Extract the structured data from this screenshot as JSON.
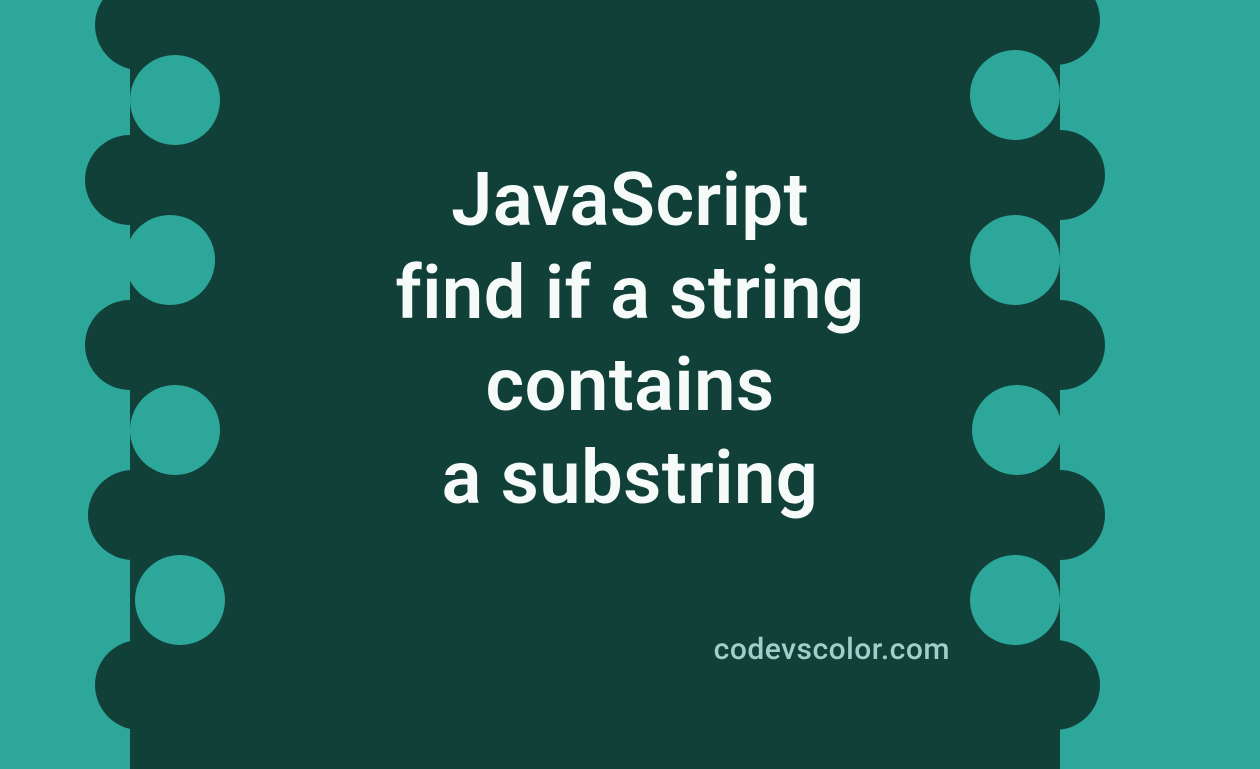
{
  "headline": {
    "line1": "JavaScript",
    "line2": "find if a string",
    "line3": "contains",
    "line4": "a substring"
  },
  "footer": {
    "site": "codevscolor.com"
  },
  "colors": {
    "bg_light": "#2da79a",
    "bg_dark": "#114039",
    "text_main": "#f6faf9",
    "text_footer": "#9ecfc8"
  }
}
